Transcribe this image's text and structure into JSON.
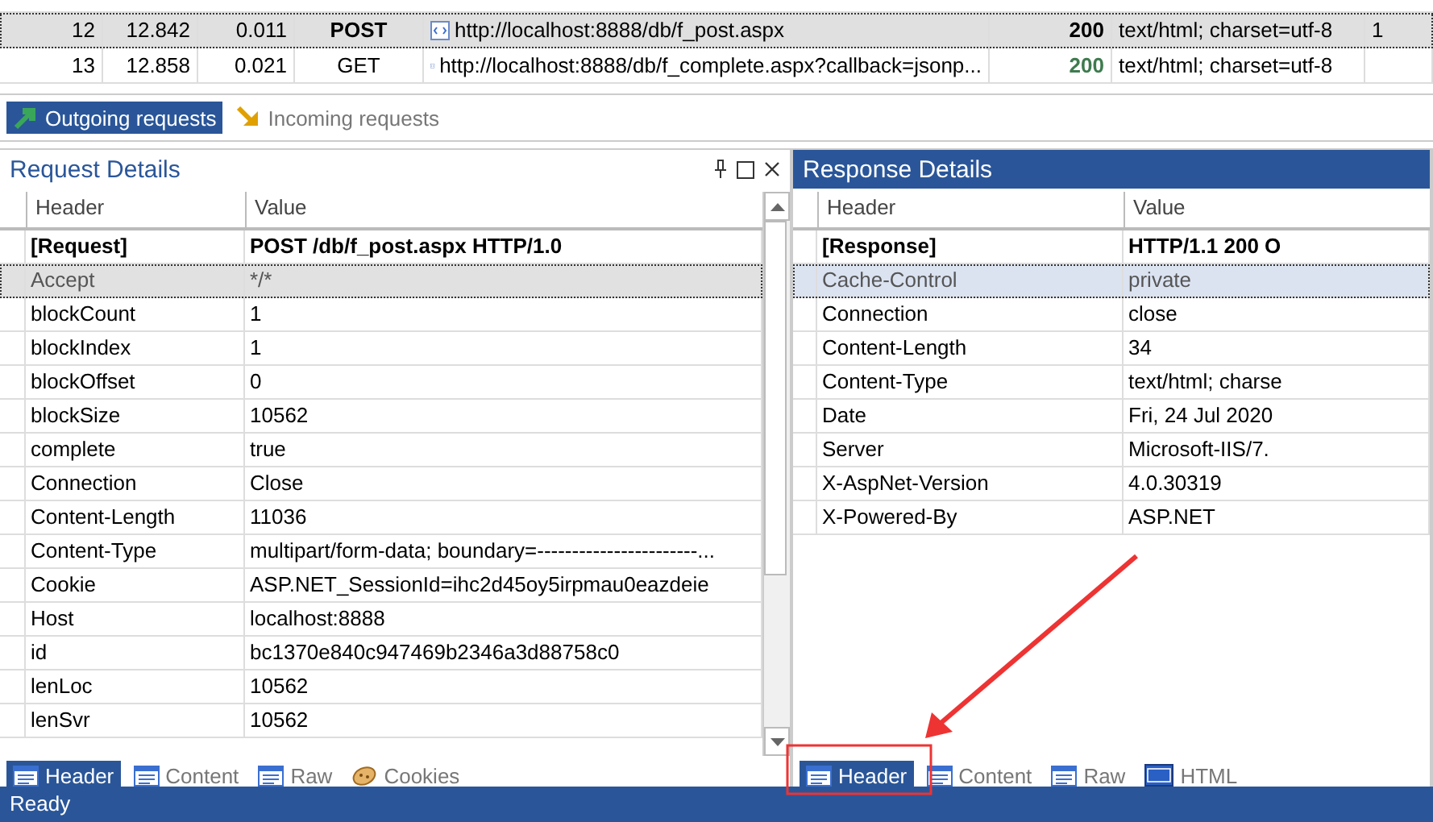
{
  "sessions": {
    "rows": [
      {
        "number": "12",
        "time": "12.842",
        "duration": "0.011",
        "method": "POST",
        "url": "http://localhost:8888/db/f_post.aspx",
        "status": "200",
        "content_type": "text/html; charset=utf-8",
        "column_8": "1",
        "selected": true
      },
      {
        "number": "13",
        "time": "12.858",
        "duration": "0.021",
        "method": "GET",
        "url": "http://localhost:8888/db/f_complete.aspx?callback=jsonp...",
        "status": "200",
        "content_type": "text/html; charset=utf-8",
        "column_8": "",
        "selected": false
      }
    ]
  },
  "direction_tabs": [
    {
      "label": "Outgoing requests",
      "kind": "outgoing",
      "selected": true
    },
    {
      "label": "Incoming requests",
      "kind": "incoming",
      "selected": false
    }
  ],
  "panels": [
    {
      "title": "Request Details",
      "active": false,
      "window_buttons": true,
      "columns": [
        "Header",
        "Value"
      ],
      "rows": [
        {
          "header": "[Request]",
          "value": "POST /db/f_post.aspx HTTP/1.0",
          "kind": "start",
          "selected": false
        },
        {
          "header": "Accept",
          "value": "*/*",
          "kind": "field",
          "selected": true
        },
        {
          "header": "blockCount",
          "value": "1",
          "kind": "field",
          "selected": false
        },
        {
          "header": "blockIndex",
          "value": "1",
          "kind": "field",
          "selected": false
        },
        {
          "header": "blockOffset",
          "value": "0",
          "kind": "field",
          "selected": false
        },
        {
          "header": "blockSize",
          "value": "10562",
          "kind": "field",
          "selected": false
        },
        {
          "header": "complete",
          "value": "true",
          "kind": "field",
          "selected": false
        },
        {
          "header": "Connection",
          "value": "Close",
          "kind": "field",
          "selected": false
        },
        {
          "header": "Content-Length",
          "value": "11036",
          "kind": "field",
          "selected": false
        },
        {
          "header": "Content-Type",
          "value": "multipart/form-data; boundary=-----------------------...",
          "kind": "field",
          "selected": false
        },
        {
          "header": "Cookie",
          "value": "ASP.NET_SessionId=ihc2d45oy5irpmau0eazdeie",
          "kind": "field",
          "selected": false
        },
        {
          "header": "Host",
          "value": "localhost:8888",
          "kind": "field",
          "selected": false
        },
        {
          "header": "id",
          "value": "bc1370e840c947469b2346a3d88758c0",
          "kind": "field",
          "selected": false
        },
        {
          "header": "lenLoc",
          "value": "10562",
          "kind": "field",
          "selected": false
        },
        {
          "header": "lenSvr",
          "value": "10562",
          "kind": "field",
          "selected": false
        }
      ],
      "tabs": [
        {
          "label": "Header",
          "kind": "grid",
          "selected": true
        },
        {
          "label": "Content",
          "kind": "grid",
          "selected": false
        },
        {
          "label": "Raw",
          "kind": "grid",
          "selected": false
        },
        {
          "label": "Cookies",
          "kind": "cookie",
          "selected": false
        }
      ]
    },
    {
      "title": "Response Details",
      "active": true,
      "window_buttons": false,
      "columns": [
        "Header",
        "Value"
      ],
      "rows": [
        {
          "header": "[Response]",
          "value": "HTTP/1.1 200 O",
          "kind": "start",
          "selected": false
        },
        {
          "header": "Cache-Control",
          "value": "private",
          "kind": "field",
          "selected": true
        },
        {
          "header": "Connection",
          "value": "close",
          "kind": "field",
          "selected": false
        },
        {
          "header": "Content-Length",
          "value": "34",
          "kind": "field",
          "selected": false
        },
        {
          "header": "Content-Type",
          "value": "text/html; charse",
          "kind": "field",
          "selected": false
        },
        {
          "header": "Date",
          "value": "Fri, 24 Jul 2020",
          "kind": "field",
          "selected": false
        },
        {
          "header": "Server",
          "value": "Microsoft-IIS/7.",
          "kind": "field",
          "selected": false
        },
        {
          "header": "X-AspNet-Version",
          "value": "4.0.30319",
          "kind": "field",
          "selected": false
        },
        {
          "header": "X-Powered-By",
          "value": "ASP.NET",
          "kind": "field",
          "selected": false
        }
      ],
      "tabs": [
        {
          "label": "Header",
          "kind": "grid",
          "selected": true
        },
        {
          "label": "Content",
          "kind": "grid",
          "selected": false
        },
        {
          "label": "Raw",
          "kind": "grid",
          "selected": false
        },
        {
          "label": "HTML",
          "kind": "html",
          "selected": false
        }
      ]
    }
  ],
  "status_bar": {
    "text": "Ready"
  }
}
